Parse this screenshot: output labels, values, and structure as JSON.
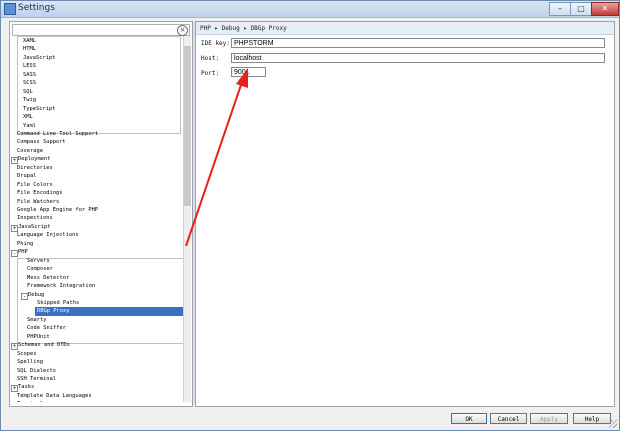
{
  "window": {
    "title": "Settings",
    "minimize_symbol": "–",
    "maximize_symbol": "□",
    "close_symbol": "✕"
  },
  "search": {
    "value": "",
    "clear_symbol": "×"
  },
  "tree": {
    "items": [
      {
        "label": "XAML",
        "expander": ""
      },
      {
        "label": "HTML",
        "expander": ""
      },
      {
        "label": "JavaScript",
        "expander": ""
      },
      {
        "label": "LESS",
        "expander": ""
      },
      {
        "label": "SASS",
        "expander": ""
      },
      {
        "label": "SCSS",
        "expander": ""
      },
      {
        "label": "SQL",
        "expander": ""
      },
      {
        "label": "Twig",
        "expander": ""
      },
      {
        "label": "TypeScript",
        "expander": ""
      },
      {
        "label": "XML",
        "expander": ""
      },
      {
        "label": "Yaml",
        "expander": ""
      },
      {
        "label": "Command Line Tool Support",
        "expander": ""
      },
      {
        "label": "Compass Support",
        "expander": ""
      },
      {
        "label": "Coverage",
        "expander": ""
      },
      {
        "label": "Deployment",
        "expander": "+"
      },
      {
        "label": "Directories",
        "expander": ""
      },
      {
        "label": "Drupal",
        "expander": ""
      },
      {
        "label": "File Colors",
        "expander": ""
      },
      {
        "label": "File Encodings",
        "expander": ""
      },
      {
        "label": "File Watchers",
        "expander": ""
      },
      {
        "label": "Google App Engine for PHP",
        "expander": ""
      },
      {
        "label": "Inspections",
        "expander": ""
      },
      {
        "label": "JavaScript",
        "expander": "+"
      },
      {
        "label": "Language Injections",
        "expander": ""
      },
      {
        "label": "Phing",
        "expander": ""
      },
      {
        "label": "PHP",
        "expander": "-"
      },
      {
        "label": "Servers",
        "expander": ""
      },
      {
        "label": "Composer",
        "expander": ""
      },
      {
        "label": "Mess Detector",
        "expander": ""
      },
      {
        "label": "Framework Integration",
        "expander": ""
      },
      {
        "label": "Debug",
        "expander": "-"
      },
      {
        "label": "Skipped Paths",
        "expander": ""
      },
      {
        "label": "DBGp Proxy",
        "expander": ""
      },
      {
        "label": "Smarty",
        "expander": ""
      },
      {
        "label": "Code Sniffer",
        "expander": ""
      },
      {
        "label": "PHPUnit",
        "expander": ""
      },
      {
        "label": "Schemas and DTDs",
        "expander": "+"
      },
      {
        "label": "Scopes",
        "expander": ""
      },
      {
        "label": "Spelling",
        "expander": ""
      },
      {
        "label": "SQL Dialects",
        "expander": ""
      },
      {
        "label": "SSH Terminal",
        "expander": ""
      },
      {
        "label": "Tasks",
        "expander": "+"
      },
      {
        "label": "Template Data Languages",
        "expander": ""
      },
      {
        "label": "Terminal",
        "expander": ""
      }
    ]
  },
  "breadcrumb": {
    "text": "PHP ▸ Debug ▸ DBGp Proxy"
  },
  "form": {
    "ide_key_label": "IDE key:",
    "ide_key_value": "PHPSTORM",
    "host_label": "Host:",
    "host_value": "localhost",
    "port_label": "Port:",
    "port_value": "9001"
  },
  "buttons": {
    "ok": "OK",
    "cancel": "Cancel",
    "apply": "Apply",
    "help": "Help"
  },
  "colors": {
    "selection": "#3b6fc4",
    "annotation_arrow": "#e8201e"
  }
}
